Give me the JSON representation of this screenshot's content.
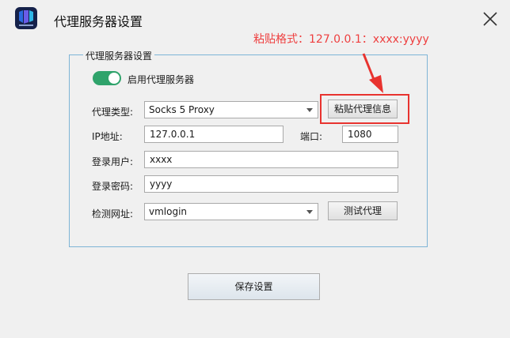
{
  "window": {
    "title": "代理服务器设置"
  },
  "hint": {
    "text": "粘贴格式：127.0.0.1：xxxx:yyyy",
    "color": "#ee3f3f"
  },
  "group": {
    "title": "代理服务器设置"
  },
  "enable": {
    "label": "启用代理服务器",
    "on": true,
    "color": "#2fa36b"
  },
  "type": {
    "label": "代理类型:",
    "value": "Socks 5 Proxy"
  },
  "paste_button": "粘贴代理信息",
  "ip": {
    "label": "IP地址:",
    "value": "127.0.0.1"
  },
  "port": {
    "label": "端口:",
    "value": "1080"
  },
  "user": {
    "label": "登录用户:",
    "value": "xxxx"
  },
  "password": {
    "label": "登录密码:",
    "value": "yyyy"
  },
  "check_url": {
    "label": "检测网址:",
    "value": "vmlogin"
  },
  "test_button": "测试代理",
  "save_button": "保存设置",
  "icons": {
    "logo": "app-logo",
    "close": "close-icon",
    "dropdown": "chevron-down-icon",
    "arrow": "annotation-arrow"
  }
}
